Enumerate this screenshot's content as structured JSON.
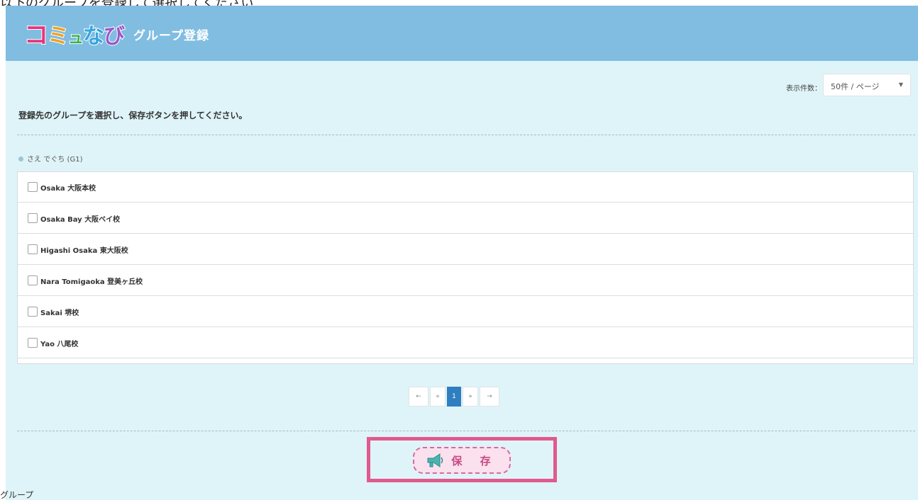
{
  "page_caption": "以下のグループを登録して選択してください",
  "header": {
    "logo_chars": [
      "コ",
      "ミ",
      "ュ",
      "な",
      "び"
    ],
    "title": "グループ登録"
  },
  "per_page": {
    "label": "表示件数：",
    "selected": "50件 / ページ"
  },
  "instruction": "登録先のグループを選択し、保存ボタンを押してください。",
  "group_label": "さえ でぐち (G1)",
  "items": [
    {
      "label": "Osaka 大阪本校",
      "checked": false
    },
    {
      "label": "Osaka Bay 大阪ベイ校",
      "checked": false
    },
    {
      "label": "Higashi Osaka 東大阪校",
      "checked": false
    },
    {
      "label": "Nara Tomigaoka 登美ヶ丘校",
      "checked": false
    },
    {
      "label": "Sakai 堺校",
      "checked": false
    },
    {
      "label": "Yao 八尾校",
      "checked": false
    }
  ],
  "pagination": {
    "first": "←",
    "prev": "«",
    "current": "1",
    "next": "»",
    "last": "→"
  },
  "save_button": {
    "label": "保 存",
    "icon": "megaphone-icon"
  },
  "bottom_fragment": "グループ",
  "colors": {
    "header_bg": "#80bde1",
    "body_bg": "#dff4f8",
    "active_page": "#2f7fc0",
    "highlight": "#e05a8e",
    "save_bg": "#fbe0ee"
  }
}
